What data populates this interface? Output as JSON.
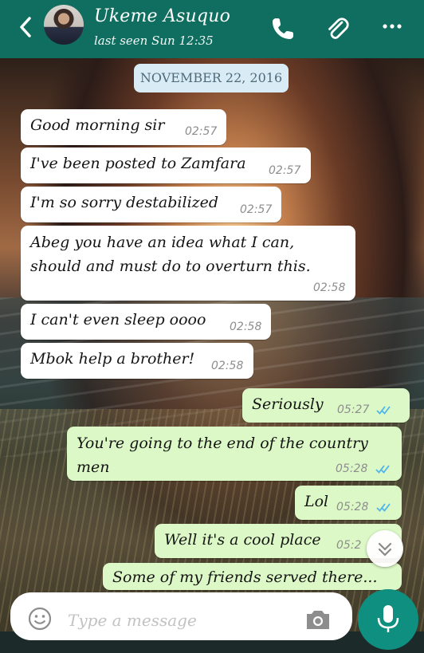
{
  "header": {
    "contact_name": "Ukeme Asuquo",
    "last_seen": "last seen Sun 12:35",
    "icons": [
      "back-arrow-icon",
      "phone-icon",
      "paperclip-icon",
      "more-vert-icon"
    ],
    "color": "#0f6e5f"
  },
  "chat": {
    "date_chip": "NOVEMBER 22, 2016",
    "messages": [
      {
        "dir": "in",
        "text": "Good morning sir",
        "time": "02:57"
      },
      {
        "dir": "in",
        "text": "I've been posted to Zamfara",
        "time": "02:57"
      },
      {
        "dir": "in",
        "text": "I'm so sorry destabilized",
        "time": "02:57"
      },
      {
        "dir": "in",
        "lines": [
          "Abeg you have an idea what I can,",
          "should and must do to overturn this."
        ],
        "time": "02:58"
      },
      {
        "dir": "in",
        "text": "I can't even sleep oooo",
        "time": "02:58"
      },
      {
        "dir": "in",
        "text": "Mbok help a brother!",
        "time": "02:58"
      },
      {
        "dir": "out",
        "text": "Seriously",
        "time": "05:27"
      },
      {
        "dir": "out",
        "lines": [
          "You're going to the end of the country",
          "men"
        ],
        "time": "05:28"
      },
      {
        "dir": "out",
        "text": "Lol",
        "time": "05:28"
      },
      {
        "dir": "out",
        "text": "Well it's a cool place",
        "time": "05:2"
      },
      {
        "dir": "out",
        "text": "Some of my friends served there..."
      }
    ],
    "incoming_color": "#ffffff",
    "outgoing_color": "#dcf8c6",
    "read_tick_color": "#4fb6ec"
  },
  "composer": {
    "placeholder": "Type a message",
    "icons": [
      "emoji-icon",
      "camera-icon",
      "mic-icon",
      "scroll-down-icon"
    ]
  }
}
